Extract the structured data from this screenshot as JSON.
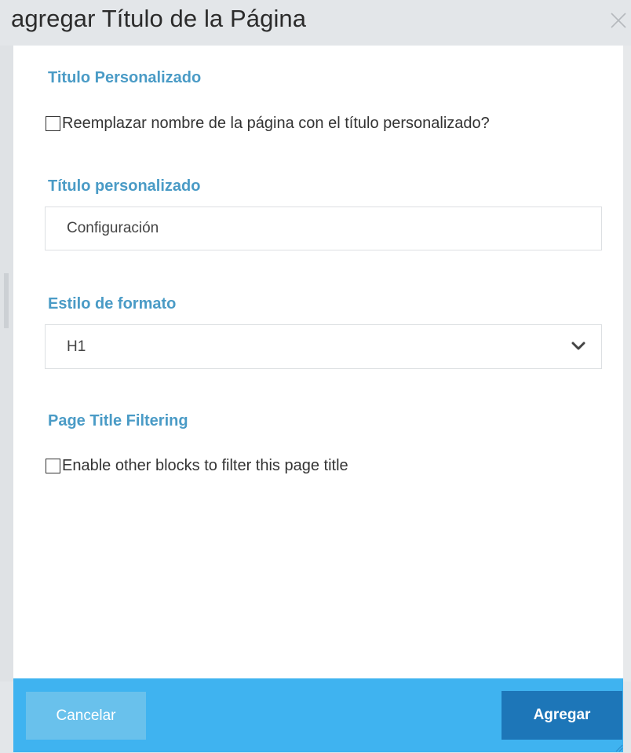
{
  "dialog": {
    "title": "agregar Título de la Página",
    "close_icon": "close-icon"
  },
  "custom_title_section": {
    "heading": "Titulo Personalizado",
    "replace_checkbox": {
      "label": "Reemplazar nombre de la página con el título personalizado?",
      "checked": false
    }
  },
  "custom_title_field": {
    "label": "Título personalizado",
    "value": "Configuración"
  },
  "format_style": {
    "label": "Estilo de formato",
    "selected": "H1",
    "icon": "chevron-down-icon"
  },
  "filtering_section": {
    "heading": "Page Title Filtering",
    "enable_checkbox": {
      "label": "Enable other blocks to filter this page title",
      "checked": false
    }
  },
  "footer": {
    "cancel_label": "Cancelar",
    "add_label": "Agregar"
  },
  "colors": {
    "accent_label": "#4a9bc6",
    "footer_bg": "#3fb3f0",
    "cancel_bg": "#69c1ec",
    "primary_button": "#1d76b8",
    "titlebar_bg": "#e3e6e9"
  }
}
